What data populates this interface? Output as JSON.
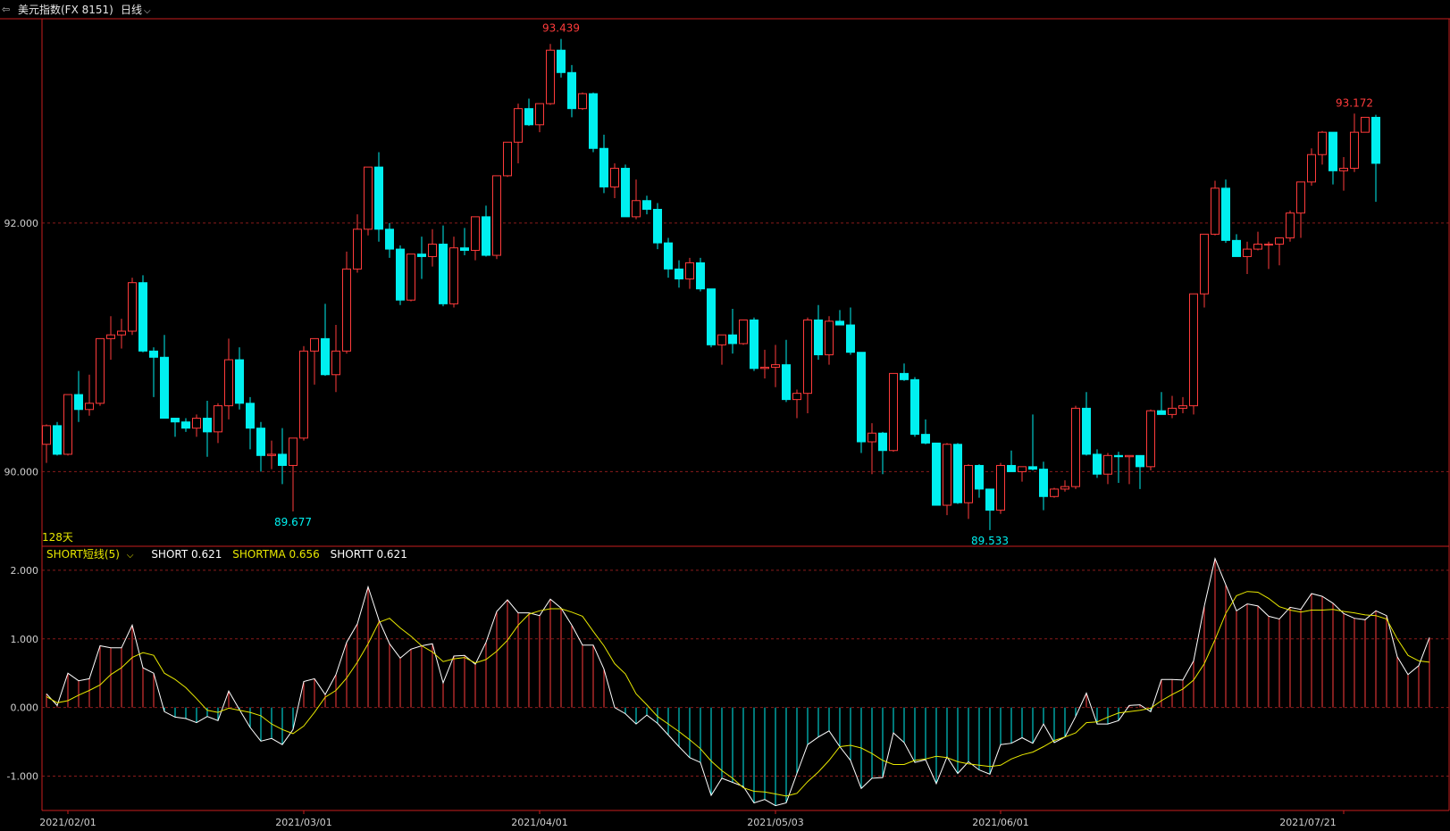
{
  "header": {
    "back_icon": "back-arrow-icon",
    "title": "美元指数(FX 8151)",
    "period": "日线",
    "period_icon": "chevron-down-icon"
  },
  "colors": {
    "up": "#ff3b3b",
    "down": "#00f0f0",
    "frame": "#c81e1e",
    "grid": "#8a1b1b",
    "axis_text": "#cfcfcf",
    "short": "#ffffff",
    "shortma": "#e8e800"
  },
  "main_panel": {
    "days_label": "128天",
    "y_ticks": [
      "92.000",
      "90.000"
    ],
    "high_label": "93.439",
    "low_label_1": "89.677",
    "low_label_2": "89.533",
    "last_high_label": "93.172"
  },
  "indicator_panel": {
    "name": "SHORT短线(5)",
    "short_label": "SHORT 0.621",
    "shortma_label": "SHORTMA 0.656",
    "shortt_label": "SHORTT 0.621",
    "y_ticks": [
      "2.000",
      "1.000",
      "0.000",
      "-1.000"
    ]
  },
  "x_ticks": [
    "2021/02/01",
    "2021/03/01",
    "2021/04/01",
    "2021/05/03",
    "2021/06/01",
    "2021/07/21"
  ],
  "chart_data": [
    {
      "type": "candlestick",
      "title": "美元指数(FX 8151)",
      "ylim": [
        89.4,
        93.65
      ],
      "y_ticks": [
        92.0,
        90.0
      ],
      "x_ticks": [
        "2021/02/01",
        "2021/03/01",
        "2021/04/01",
        "2021/05/03",
        "2021/06/01",
        "2021/07/21"
      ],
      "annotations": {
        "max": 93.439,
        "min_1": 89.677,
        "min_2": 89.533,
        "recent_high": 93.172
      },
      "candles": [
        [
          90.22,
          90.38,
          90.07,
          90.37
        ],
        [
          90.37,
          90.4,
          90.13,
          90.14
        ],
        [
          90.14,
          90.62,
          90.13,
          90.62
        ],
        [
          90.62,
          90.81,
          90.4,
          90.5
        ],
        [
          90.5,
          90.78,
          90.45,
          90.55
        ],
        [
          90.55,
          91.07,
          90.53,
          91.07
        ],
        [
          91.07,
          91.25,
          90.9,
          91.1
        ],
        [
          91.1,
          91.23,
          90.99,
          91.13
        ],
        [
          91.13,
          91.56,
          91.1,
          91.52
        ],
        [
          91.52,
          91.58,
          90.96,
          90.97
        ],
        [
          90.97,
          91.0,
          90.6,
          90.92
        ],
        [
          90.92,
          91.1,
          90.45,
          90.43
        ],
        [
          90.43,
          90.43,
          90.28,
          90.4
        ],
        [
          90.4,
          90.43,
          90.32,
          90.35
        ],
        [
          90.35,
          90.46,
          90.28,
          90.43
        ],
        [
          90.43,
          90.57,
          90.12,
          90.32
        ],
        [
          90.32,
          90.55,
          90.23,
          90.53
        ],
        [
          90.53,
          91.07,
          90.42,
          90.9
        ],
        [
          90.9,
          91.0,
          90.5,
          90.55
        ],
        [
          90.55,
          90.6,
          90.18,
          90.35
        ],
        [
          90.35,
          90.4,
          90.0,
          90.13
        ],
        [
          90.13,
          90.25,
          90.02,
          90.14
        ],
        [
          90.14,
          90.35,
          89.9,
          90.05
        ],
        [
          90.05,
          90.27,
          89.68,
          90.27
        ],
        [
          90.27,
          91.01,
          90.25,
          90.97
        ],
        [
          90.97,
          91.03,
          90.7,
          91.07
        ],
        [
          91.07,
          91.35,
          90.77,
          90.78
        ],
        [
          90.78,
          91.18,
          90.64,
          90.97
        ],
        [
          90.97,
          91.77,
          90.95,
          91.63
        ],
        [
          91.63,
          92.07,
          91.6,
          91.95
        ],
        [
          91.95,
          92.45,
          91.9,
          92.45
        ],
        [
          92.45,
          92.57,
          91.85,
          91.95
        ],
        [
          91.95,
          92.0,
          91.72,
          91.79
        ],
        [
          91.79,
          91.82,
          91.34,
          91.38
        ],
        [
          91.38,
          91.73,
          91.37,
          91.75
        ],
        [
          91.75,
          91.89,
          91.55,
          91.73
        ],
        [
          91.73,
          91.95,
          91.65,
          91.83
        ],
        [
          91.83,
          91.98,
          91.33,
          91.35
        ],
        [
          91.35,
          91.89,
          91.32,
          91.8
        ],
        [
          91.8,
          91.96,
          91.74,
          91.78
        ],
        [
          91.78,
          92.05,
          91.7,
          92.05
        ],
        [
          92.05,
          92.14,
          91.73,
          91.74
        ],
        [
          91.74,
          92.38,
          91.71,
          92.38
        ],
        [
          92.38,
          92.65,
          92.37,
          92.65
        ],
        [
          92.65,
          92.96,
          92.48,
          92.92
        ],
        [
          92.92,
          93.0,
          92.78,
          92.79
        ],
        [
          92.79,
          92.96,
          92.73,
          92.96
        ],
        [
          92.96,
          93.44,
          92.95,
          93.39
        ],
        [
          93.39,
          93.48,
          93.17,
          93.21
        ],
        [
          93.21,
          93.27,
          92.85,
          92.92
        ],
        [
          92.92,
          93.05,
          92.91,
          93.04
        ],
        [
          93.04,
          93.05,
          92.57,
          92.6
        ],
        [
          92.6,
          92.71,
          92.24,
          92.29
        ],
        [
          92.29,
          92.48,
          92.2,
          92.44
        ],
        [
          92.44,
          92.47,
          92.05,
          92.05
        ],
        [
          92.05,
          92.35,
          92.03,
          92.18
        ],
        [
          92.18,
          92.22,
          92.07,
          92.11
        ],
        [
          92.11,
          92.16,
          91.79,
          91.84
        ],
        [
          91.84,
          91.88,
          91.56,
          91.63
        ],
        [
          91.63,
          91.7,
          91.48,
          91.55
        ],
        [
          91.55,
          91.72,
          91.47,
          91.68
        ],
        [
          91.68,
          91.72,
          91.45,
          91.47
        ],
        [
          91.47,
          91.47,
          91.0,
          91.02
        ],
        [
          91.02,
          91.1,
          90.86,
          91.1
        ],
        [
          91.1,
          91.31,
          90.95,
          91.03
        ],
        [
          91.03,
          91.22,
          91.02,
          91.22
        ],
        [
          91.22,
          91.24,
          90.81,
          90.83
        ],
        [
          90.83,
          90.98,
          90.75,
          90.84
        ],
        [
          90.84,
          91.02,
          90.68,
          90.86
        ],
        [
          90.86,
          91.06,
          90.56,
          90.58
        ],
        [
          90.58,
          90.66,
          90.43,
          90.63
        ],
        [
          90.63,
          91.24,
          90.47,
          91.22
        ],
        [
          91.22,
          91.34,
          90.9,
          90.94
        ],
        [
          90.94,
          91.25,
          90.86,
          91.21
        ],
        [
          91.21,
          91.3,
          91.18,
          91.18
        ],
        [
          91.18,
          91.32,
          90.94,
          90.96
        ],
        [
          90.96,
          90.96,
          90.15,
          90.24
        ],
        [
          90.24,
          90.39,
          89.98,
          90.31
        ],
        [
          90.31,
          90.32,
          89.98,
          90.17
        ],
        [
          90.17,
          90.79,
          90.16,
          90.79
        ],
        [
          90.79,
          90.87,
          90.73,
          90.74
        ],
        [
          90.74,
          90.76,
          90.28,
          90.3
        ],
        [
          90.3,
          90.42,
          90.22,
          90.23
        ],
        [
          90.23,
          90.23,
          89.78,
          89.73
        ],
        [
          89.73,
          90.23,
          89.65,
          90.22
        ],
        [
          90.22,
          90.23,
          89.74,
          89.75
        ],
        [
          89.75,
          90.06,
          89.62,
          90.05
        ],
        [
          90.05,
          90.06,
          89.79,
          89.86
        ],
        [
          89.86,
          89.86,
          89.53,
          89.69
        ],
        [
          89.69,
          90.07,
          89.66,
          90.05
        ],
        [
          90.05,
          90.17,
          90.01,
          90.0
        ],
        [
          90.0,
          90.0,
          89.92,
          90.04
        ],
        [
          90.04,
          90.46,
          90.01,
          90.02
        ],
        [
          90.02,
          90.08,
          89.69,
          89.8
        ],
        [
          89.8,
          89.87,
          89.79,
          89.86
        ],
        [
          89.86,
          89.93,
          89.84,
          89.88
        ],
        [
          89.88,
          90.53,
          89.86,
          90.51
        ],
        [
          90.51,
          90.64,
          90.13,
          90.14
        ],
        [
          90.14,
          90.18,
          89.95,
          89.98
        ],
        [
          89.98,
          90.15,
          89.9,
          90.13
        ],
        [
          90.13,
          90.16,
          89.91,
          90.12
        ],
        [
          90.12,
          90.13,
          89.9,
          90.13
        ],
        [
          90.13,
          90.12,
          89.86,
          90.04
        ],
        [
          90.04,
          90.5,
          90.01,
          90.49
        ],
        [
          90.49,
          90.64,
          90.47,
          90.46
        ],
        [
          90.46,
          90.61,
          90.43,
          90.51
        ],
        [
          90.51,
          90.6,
          90.47,
          90.53
        ],
        [
          90.53,
          91.43,
          90.46,
          91.43
        ],
        [
          91.43,
          91.88,
          91.32,
          91.91
        ],
        [
          91.91,
          92.34,
          91.9,
          92.28
        ],
        [
          92.28,
          92.35,
          91.84,
          91.86
        ],
        [
          91.86,
          91.91,
          91.73,
          91.73
        ],
        [
          91.73,
          91.85,
          91.59,
          91.79
        ],
        [
          91.79,
          91.93,
          91.78,
          91.83
        ],
        [
          91.83,
          91.85,
          91.63,
          91.83
        ],
        [
          91.83,
          91.84,
          91.66,
          91.88
        ],
        [
          91.88,
          92.1,
          91.85,
          92.08
        ],
        [
          92.08,
          92.25,
          91.88,
          92.33
        ],
        [
          92.33,
          92.6,
          92.3,
          92.55
        ],
        [
          92.55,
          92.74,
          92.47,
          92.73
        ],
        [
          92.73,
          92.72,
          92.31,
          92.42
        ],
        [
          92.42,
          92.53,
          92.26,
          92.44
        ],
        [
          92.44,
          92.88,
          92.41,
          92.73
        ],
        [
          92.73,
          92.85,
          92.73,
          92.85
        ],
        [
          92.85,
          92.87,
          92.17,
          92.48
        ]
      ]
    },
    {
      "type": "bar+line",
      "title": "SHORT短线(5)",
      "ylim": [
        -1.5,
        2.35
      ],
      "y_ticks": [
        2.0,
        1.0,
        0.0,
        -1.0
      ],
      "series": [
        {
          "name": "SHORT",
          "values": [
            0.2,
            0.03,
            0.5,
            0.39,
            0.42,
            0.9,
            0.87,
            0.87,
            1.2,
            0.58,
            0.5,
            -0.06,
            -0.14,
            -0.16,
            -0.22,
            -0.13,
            -0.19,
            0.24,
            -0.03,
            -0.29,
            -0.49,
            -0.45,
            -0.54,
            -0.32,
            0.38,
            0.42,
            0.19,
            0.48,
            0.95,
            1.22,
            1.76,
            1.28,
            0.93,
            0.72,
            0.85,
            0.9,
            0.93,
            0.36,
            0.75,
            0.76,
            0.63,
            0.95,
            1.4,
            1.57,
            1.38,
            1.38,
            1.34,
            1.58,
            1.45,
            1.2,
            0.91,
            0.91,
            0.56,
            0.0,
            -0.09,
            -0.24,
            -0.11,
            -0.23,
            -0.4,
            -0.57,
            -0.73,
            -0.8,
            -1.28,
            -1.03,
            -1.09,
            -1.15,
            -1.39,
            -1.34,
            -1.43,
            -1.39,
            -0.96,
            -0.54,
            -0.43,
            -0.34,
            -0.57,
            -0.77,
            -1.18,
            -1.03,
            -1.02,
            -0.37,
            -0.51,
            -0.8,
            -0.76,
            -1.11,
            -0.72,
            -0.96,
            -0.79,
            -0.91,
            -0.97,
            -0.54,
            -0.52,
            -0.44,
            -0.52,
            -0.24,
            -0.51,
            -0.43,
            -0.13,
            0.21,
            -0.24,
            -0.24,
            -0.19,
            0.03,
            0.04,
            -0.06,
            0.41,
            0.41,
            0.4,
            0.68,
            1.48,
            2.17,
            1.79,
            1.41,
            1.51,
            1.48,
            1.33,
            1.29,
            1.46,
            1.43,
            1.66,
            1.62,
            1.52,
            1.37,
            1.3,
            1.28,
            1.41,
            1.34,
            0.74,
            0.48,
            0.61,
            1.02
          ]
        },
        {
          "name": "SHORTMA",
          "values": [
            0.16,
            0.07,
            0.1,
            0.18,
            0.25,
            0.33,
            0.48,
            0.58,
            0.73,
            0.8,
            0.76,
            0.5,
            0.41,
            0.29,
            0.13,
            -0.04,
            -0.07,
            -0.01,
            -0.04,
            -0.07,
            -0.12,
            -0.24,
            -0.32,
            -0.38,
            -0.27,
            -0.07,
            0.15,
            0.25,
            0.43,
            0.66,
            0.93,
            1.24,
            1.3,
            1.16,
            1.04,
            0.9,
            0.81,
            0.67,
            0.71,
            0.73,
            0.65,
            0.7,
            0.82,
            0.98,
            1.2,
            1.36,
            1.41,
            1.44,
            1.44,
            1.39,
            1.33,
            1.11,
            0.9,
            0.64,
            0.49,
            0.2,
            0.04,
            -0.13,
            -0.24,
            -0.35,
            -0.47,
            -0.6,
            -0.78,
            -0.92,
            -1.03,
            -1.17,
            -1.22,
            -1.23,
            -1.26,
            -1.29,
            -1.25,
            -1.08,
            -0.94,
            -0.77,
            -0.57,
            -0.55,
            -0.59,
            -0.67,
            -0.77,
            -0.83,
            -0.83,
            -0.77,
            -0.75,
            -0.71,
            -0.73,
            -0.79,
            -0.82,
            -0.84,
            -0.86,
            -0.84,
            -0.75,
            -0.69,
            -0.65,
            -0.57,
            -0.48,
            -0.43,
            -0.37,
            -0.22,
            -0.21,
            -0.14,
            -0.08,
            -0.06,
            -0.04,
            -0.01,
            0.1,
            0.19,
            0.27,
            0.4,
            0.64,
            0.99,
            1.37,
            1.63,
            1.69,
            1.68,
            1.59,
            1.47,
            1.42,
            1.39,
            1.42,
            1.42,
            1.43,
            1.4,
            1.38,
            1.35,
            1.34,
            1.29,
            1.0,
            0.76,
            0.68,
            0.66
          ]
        }
      ]
    }
  ]
}
